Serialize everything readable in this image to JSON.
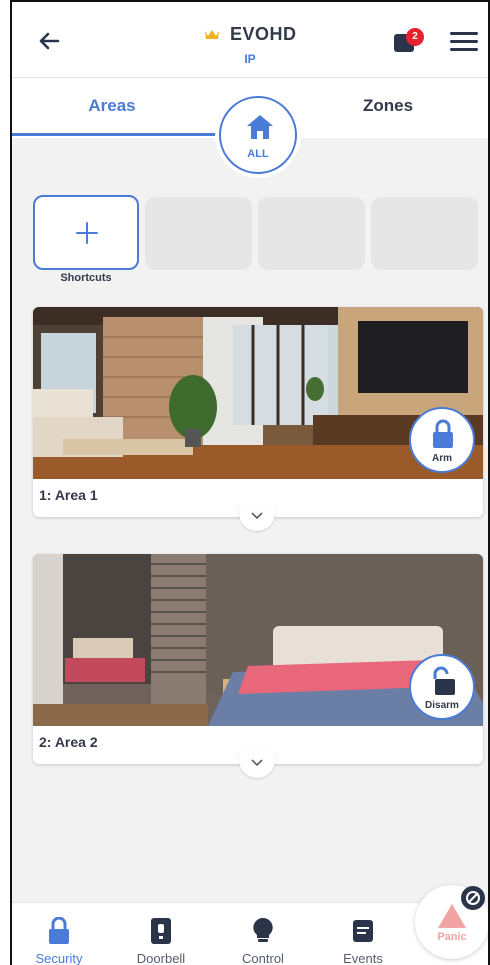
{
  "header": {
    "title": "EVOHD",
    "subtitle": "IP",
    "notification_count": "2"
  },
  "tabs": {
    "areas": "Areas",
    "zones": "Zones",
    "all": "ALL"
  },
  "shortcuts": {
    "label": "Shortcuts"
  },
  "areas": [
    {
      "name": "1: Area 1",
      "action": "Arm",
      "state": "disarmed"
    },
    {
      "name": "2: Area 2",
      "action": "Disarm",
      "state": "armed"
    }
  ],
  "bottom_nav": {
    "items": [
      {
        "label": "Security",
        "icon": "lock-icon",
        "active": true
      },
      {
        "label": "Doorbell",
        "icon": "doorbell-icon",
        "active": false
      },
      {
        "label": "Control",
        "icon": "bulb-icon",
        "active": false
      },
      {
        "label": "Events",
        "icon": "events-icon",
        "active": false
      }
    ],
    "panic_label": "Panic"
  },
  "colors": {
    "accent": "#4a7bd6",
    "text_dark": "#333a4a",
    "badge": "#e5232e",
    "crown": "#f2b01e"
  }
}
